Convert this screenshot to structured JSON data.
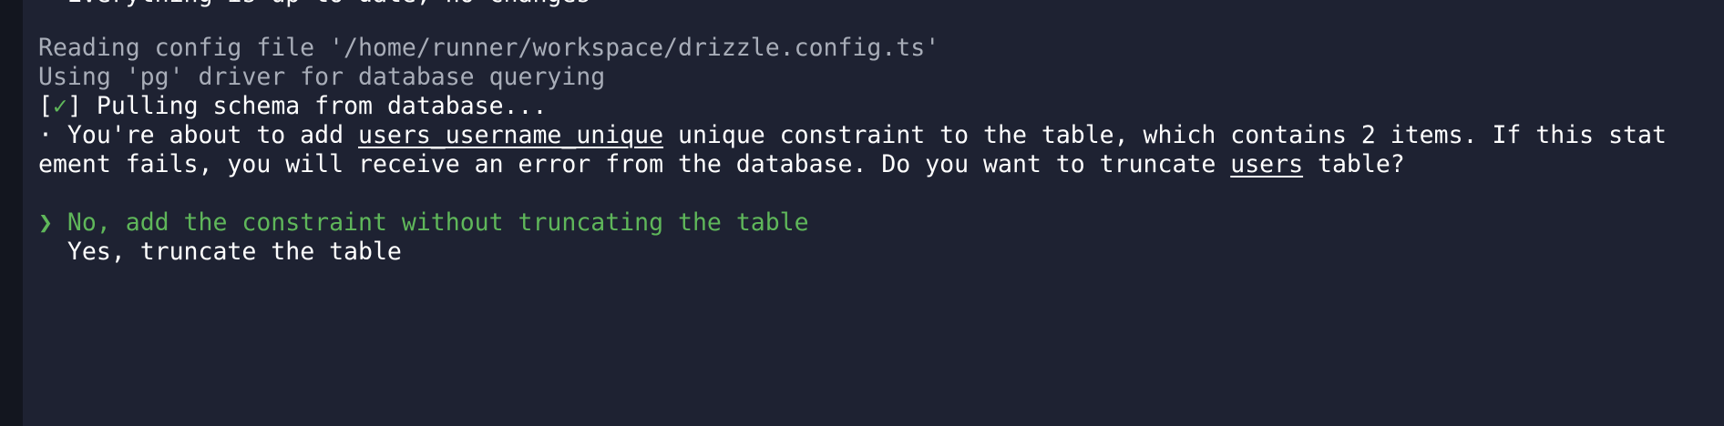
{
  "terminal": {
    "clipped_top_line": "  Everything is up to date, no changes",
    "reading_config": "Reading config file '/home/runner/workspace/drizzle.config.ts'",
    "using_driver": "Using 'pg' driver for database querying",
    "pull": {
      "bracket_open": "[",
      "check": "✓",
      "bracket_close": "]",
      "text": " Pulling schema from database..."
    },
    "warning": {
      "prefix": "· You're about to add ",
      "constraint": "users_username_unique",
      "middle_line1": " unique constraint to the table, which contains 2 items. If this stat",
      "middle_line2": "ement fails, you will receive an error from the database. Do you want to truncate ",
      "table": "users",
      "suffix": " table?"
    },
    "options": [
      {
        "pointer": "❯ ",
        "label": "No, add the constraint without truncating the table",
        "selected": true
      },
      {
        "pointer": "  ",
        "label": "Yes, truncate the table",
        "selected": false
      }
    ]
  },
  "colors": {
    "background": "#1e2232",
    "rail": "#13161f",
    "muted_text": "#a8adb8",
    "text": "#ffffff",
    "accent_green": "#5fb75a"
  }
}
